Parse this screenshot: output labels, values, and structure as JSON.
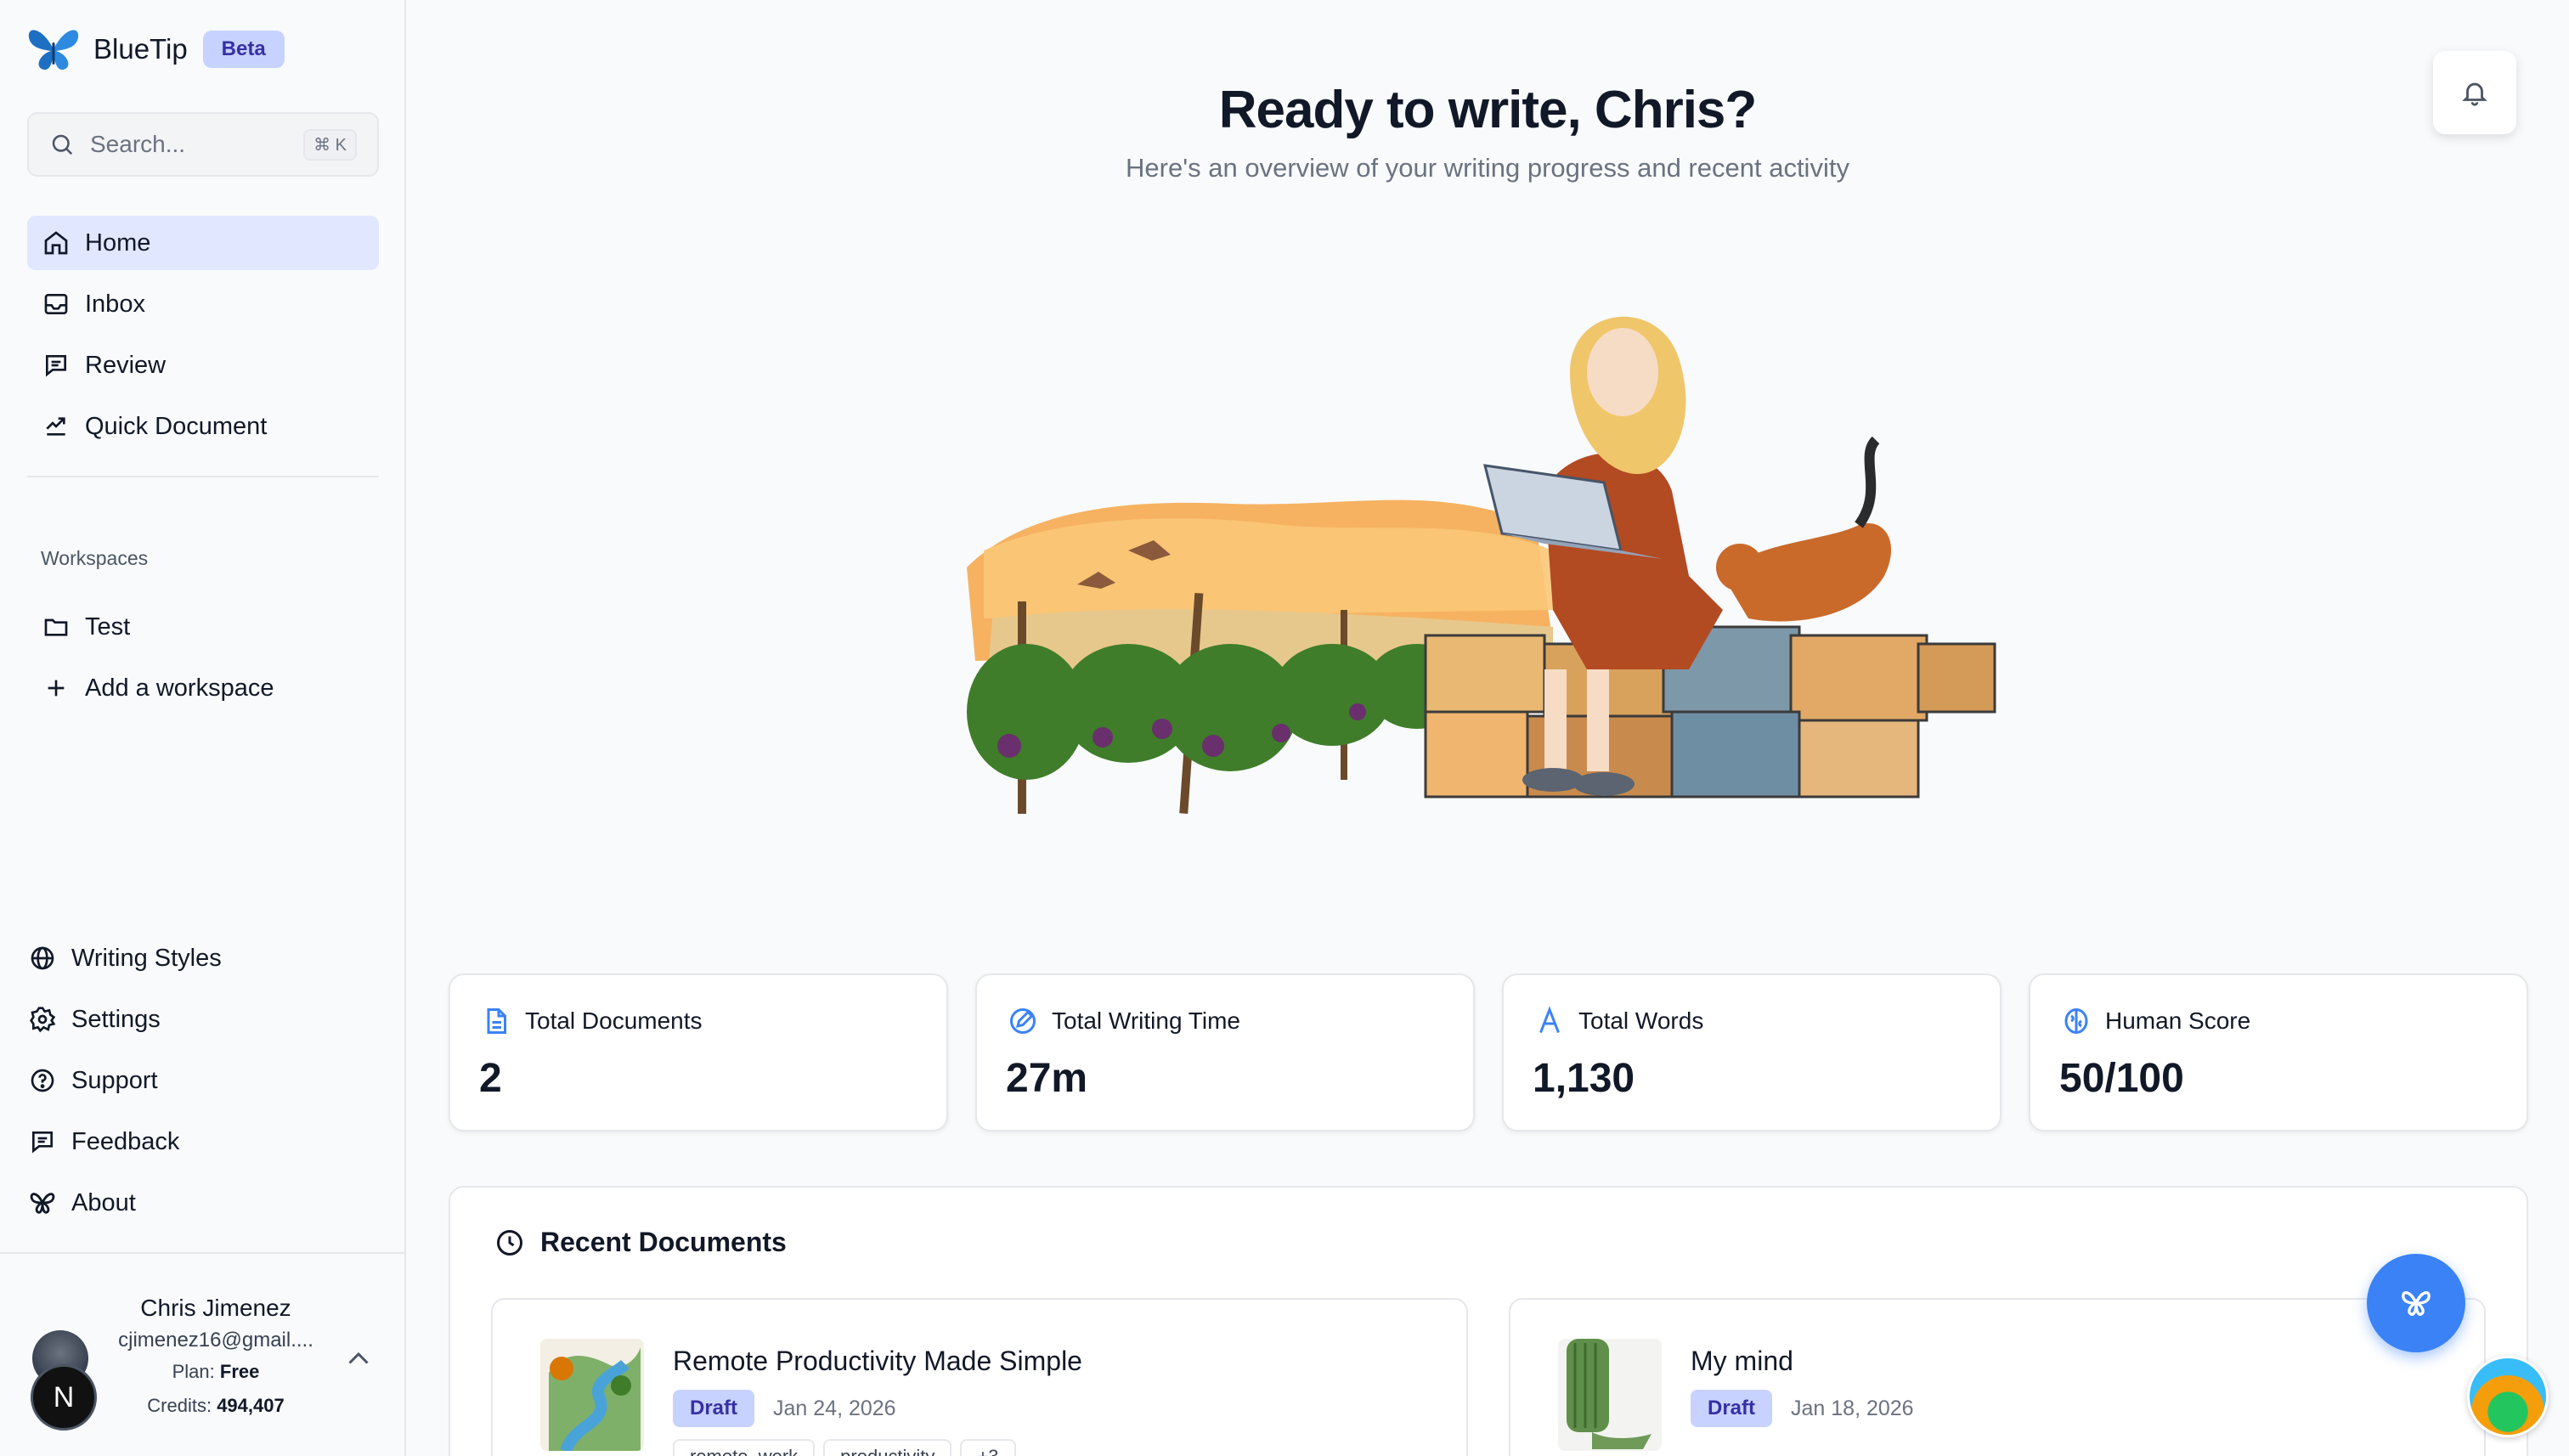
{
  "app": {
    "name": "BlueTip",
    "badge": "Beta"
  },
  "search": {
    "placeholder": "Search...",
    "shortcut": "⌘ K"
  },
  "nav": [
    {
      "label": "Home",
      "icon": "home-icon",
      "active": true
    },
    {
      "label": "Inbox",
      "icon": "inbox-icon"
    },
    {
      "label": "Review",
      "icon": "comment-icon"
    },
    {
      "label": "Quick Document",
      "icon": "quick-document-icon"
    }
  ],
  "workspaces": {
    "heading": "Workspaces",
    "items": [
      {
        "label": "Test",
        "icon": "folder-icon"
      }
    ],
    "add_label": "Add a workspace"
  },
  "bottom_nav": [
    {
      "label": "Writing Styles",
      "icon": "globe-icon"
    },
    {
      "label": "Settings",
      "icon": "gear-icon"
    },
    {
      "label": "Support",
      "icon": "help-circle-icon"
    },
    {
      "label": "Feedback",
      "icon": "comment-icon"
    },
    {
      "label": "About",
      "icon": "butterfly-icon"
    }
  ],
  "user": {
    "name": "Chris Jimenez",
    "email": "cjimenez16@gmail....",
    "plan_label": "Plan:",
    "plan": "Free",
    "credits_label": "Credits:",
    "credits": "494,407",
    "initial": "N"
  },
  "main": {
    "headline": "Ready to write, Chris?",
    "subheadline": "Here's an overview of your writing progress and recent activity"
  },
  "stats": [
    {
      "label": "Total Documents",
      "value": "2",
      "icon": "document-icon"
    },
    {
      "label": "Total Writing Time",
      "value": "27m",
      "icon": "pen-icon"
    },
    {
      "label": "Total Words",
      "value": "1,130",
      "icon": "letter-a-icon"
    },
    {
      "label": "Human Score",
      "value": "50/100",
      "icon": "brain-icon"
    }
  ],
  "recent": {
    "title": "Recent Documents",
    "documents": [
      {
        "title": "Remote Productivity Made Simple",
        "status": "Draft",
        "date": "Jan 24, 2026",
        "tags": [
          "remote_work",
          "productivity",
          "+3"
        ]
      },
      {
        "title": "My mind",
        "status": "Draft",
        "date": "Jan 18, 2026",
        "tags": []
      }
    ]
  },
  "colors": {
    "accent": "#3b82f6",
    "badge_bg": "#c7d2fe",
    "badge_text": "#3730a3",
    "active_nav": "#e0e7ff"
  }
}
